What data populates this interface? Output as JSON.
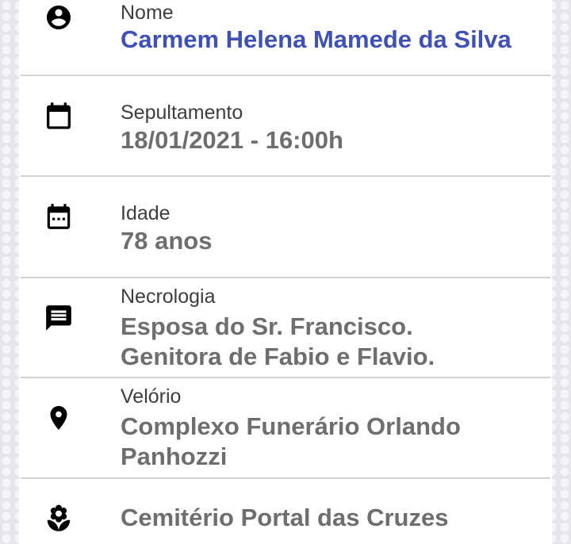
{
  "fields": {
    "nome": {
      "icon": "account-circle-icon",
      "label": "Nome",
      "value": "Carmem Helena Mamede da Silva",
      "value_color": "#3f51b5"
    },
    "sepultamento": {
      "icon": "calendar-icon",
      "label": "Sepultamento",
      "value": "18/01/2021 - 16:00h"
    },
    "idade": {
      "icon": "calendar-dots-icon",
      "label": "Idade",
      "value": "78 anos"
    },
    "necrologia": {
      "icon": "message-icon",
      "label": "Necrologia",
      "value_lines": [
        "Esposa do Sr. Francisco.",
        "Genitora de Fabio e Flavio."
      ]
    },
    "velorio": {
      "icon": "location-pin-icon",
      "label": "Velório",
      "value_lines": [
        "Complexo Funerário Orlando",
        "Panhozzi"
      ]
    },
    "cemiterio": {
      "icon": "flower-icon",
      "value": "Cemitério Portal das Cruzes"
    }
  },
  "colors": {
    "label": "#3d3d3d",
    "value": "#6e6e6e",
    "accent": "#3f51b5",
    "divider": "#d2d2d2"
  }
}
